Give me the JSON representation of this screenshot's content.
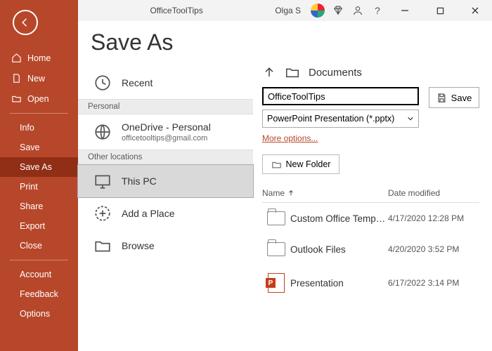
{
  "titlebar": {
    "app_title": "OfficeToolTips",
    "user_name": "Olga S"
  },
  "sidebar": {
    "group1": [
      {
        "label": "Home",
        "icon": "home"
      },
      {
        "label": "New",
        "icon": "new"
      },
      {
        "label": "Open",
        "icon": "open"
      }
    ],
    "group2": [
      {
        "label": "Info"
      },
      {
        "label": "Save"
      },
      {
        "label": "Save As",
        "selected": true
      },
      {
        "label": "Print"
      },
      {
        "label": "Share"
      },
      {
        "label": "Export"
      },
      {
        "label": "Close"
      }
    ],
    "group3": [
      {
        "label": "Account"
      },
      {
        "label": "Feedback"
      },
      {
        "label": "Options"
      }
    ]
  },
  "page": {
    "title": "Save As",
    "locations": {
      "recent_label": "Recent",
      "personal_header": "Personal",
      "onedrive_label": "OneDrive - Personal",
      "onedrive_sub": "officetooltips@gmail.com",
      "other_header": "Other locations",
      "thispc_label": "This PC",
      "addplace_label": "Add a Place",
      "browse_label": "Browse"
    },
    "browser": {
      "breadcrumb": "Documents",
      "filename": "OfficeToolTips",
      "filetype": "PowerPoint Presentation (*.pptx)",
      "more_options": "More options...",
      "save_button": "Save",
      "new_folder": "New Folder",
      "col_name": "Name",
      "col_date": "Date modified",
      "files": [
        {
          "name": "Custom Office Temp…",
          "date": "4/17/2020 12:28 PM",
          "type": "folder"
        },
        {
          "name": "Outlook Files",
          "date": "4/20/2020 3:52 PM",
          "type": "folder"
        },
        {
          "name": "Presentation",
          "date": "6/17/2022 3:14 PM",
          "type": "pptx"
        }
      ]
    }
  }
}
